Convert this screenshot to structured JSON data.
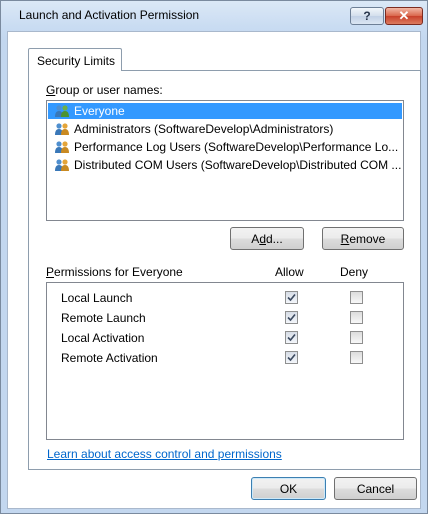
{
  "window": {
    "title": "Launch and Activation Permission",
    "help_label": "?",
    "close_label": "✕"
  },
  "tabs": [
    {
      "label": "Security Limits",
      "active": true
    }
  ],
  "groups": {
    "label_pre": "",
    "label_acc": "G",
    "label_post": "roup or user names:",
    "items": [
      {
        "label": "Everyone",
        "selected": true
      },
      {
        "label": "Administrators (SoftwareDevelop\\Administrators)",
        "selected": false
      },
      {
        "label": "Performance Log Users (SoftwareDevelop\\Performance Lo...",
        "selected": false
      },
      {
        "label": "Distributed COM Users (SoftwareDevelop\\Distributed COM ...",
        "selected": false
      }
    ]
  },
  "buttons": {
    "add_pre": "A",
    "add_acc": "d",
    "add_post": "d...",
    "remove_pre": "",
    "remove_acc": "R",
    "remove_post": "emove",
    "ok": "OK",
    "cancel": "Cancel"
  },
  "permissions": {
    "header_pre": "",
    "header_acc": "P",
    "header_post": "ermissions for Everyone",
    "allow_header": "Allow",
    "deny_header": "Deny",
    "rows": [
      {
        "name": "Local Launch",
        "allow": true,
        "deny": false
      },
      {
        "name": "Remote Launch",
        "allow": true,
        "deny": false
      },
      {
        "name": "Local Activation",
        "allow": true,
        "deny": false
      },
      {
        "name": "Remote Activation",
        "allow": true,
        "deny": false
      }
    ]
  },
  "link": {
    "text": "Learn about access control and permissions"
  }
}
